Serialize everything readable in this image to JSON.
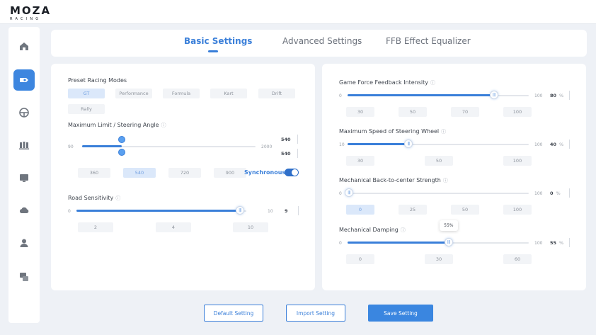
{
  "logo": {
    "title": "MOZA",
    "subtitle": "RACING"
  },
  "sidebar": {
    "items": [
      {
        "name": "home-icon",
        "active": false
      },
      {
        "name": "wheelbase-icon",
        "active": true
      },
      {
        "name": "steering-wheel-icon",
        "active": false
      },
      {
        "name": "pedals-icon",
        "active": false
      },
      {
        "name": "dashboard-icon",
        "active": false
      },
      {
        "name": "cloud-icon",
        "active": false
      },
      {
        "name": "user-icon",
        "active": false
      },
      {
        "name": "support-icon",
        "active": false
      }
    ]
  },
  "tabs": [
    {
      "label": "Basic Settings",
      "active": true
    },
    {
      "label": "Advanced Settings",
      "active": false
    },
    {
      "label": "FFB Effect Equalizer",
      "active": false
    }
  ],
  "left": {
    "preset": {
      "label": "Preset Racing Modes",
      "options": [
        "GT",
        "Performance",
        "Formula",
        "Kart",
        "Drift",
        "Rally"
      ],
      "selected": "GT"
    },
    "max_limit": {
      "label": "Maximum Limit / Steering Angle",
      "min": "90",
      "max": "2000",
      "limit_value": "540",
      "angle_value": "540",
      "limit_fraction": 0.23,
      "angle_fraction": 0.23,
      "presets": [
        "360",
        "540",
        "720",
        "900"
      ],
      "selected": "540",
      "sync_label": "Synchronous",
      "sync_on": true
    },
    "road": {
      "label": "Road Sensitivity",
      "min": "0",
      "max": "10",
      "value": "9",
      "fraction": 0.9,
      "presets": [
        "2",
        "4",
        "10"
      ]
    }
  },
  "right": {
    "ffb": {
      "label": "Game Force Feedback Intensity",
      "min": "0",
      "max": "100",
      "value": "80",
      "unit": "%",
      "fraction": 0.8,
      "presets": [
        "30",
        "50",
        "70",
        "100"
      ]
    },
    "max_speed": {
      "label": "Maximum Speed of Steering Wheel",
      "min": "10",
      "max": "100",
      "value": "40",
      "unit": "%",
      "fraction": 0.33,
      "presets": [
        "30",
        "50",
        "100"
      ]
    },
    "back_center": {
      "label": "Mechanical Back-to-center Strength",
      "min": "0",
      "max": "100",
      "value": "0",
      "unit": "%",
      "fraction": 0.0,
      "presets": [
        "0",
        "25",
        "50",
        "100"
      ],
      "selected": "0"
    },
    "damping": {
      "label": "Mechanical Damping",
      "min": "0",
      "max": "100",
      "value": "55",
      "unit": "%",
      "fraction": 0.55,
      "tooltip": "55%",
      "presets": [
        "0",
        "30",
        "60"
      ]
    }
  },
  "buttons": {
    "default": "Default Setting",
    "import": "Import Setting",
    "save": "Save Setting"
  },
  "colors": {
    "accent": "#3a7fd9",
    "sidebar_active": "#3d86df",
    "background": "#eef1f6"
  }
}
